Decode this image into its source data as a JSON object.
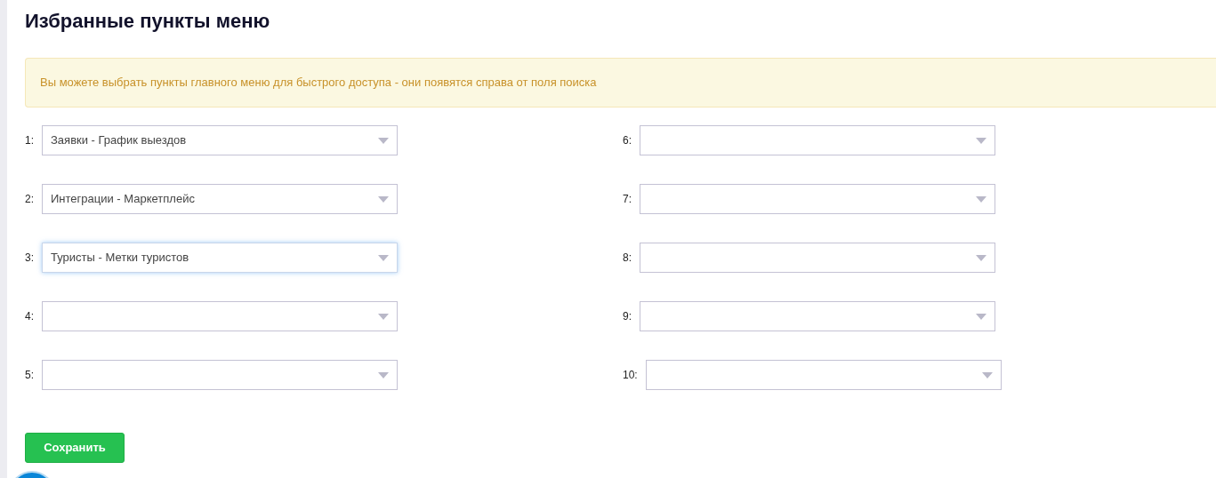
{
  "page": {
    "title": "Избранные пункты меню"
  },
  "notice": "Вы можете выбрать пункты главного меню для быстрого доступа - они появятся справа от поля поиска",
  "slots": [
    {
      "number": "1:",
      "value": "Заявки - График выездов",
      "focused": false
    },
    {
      "number": "2:",
      "value": "Интеграции - Маркетплейс",
      "focused": false
    },
    {
      "number": "3:",
      "value": "Туристы - Метки туристов",
      "focused": true
    },
    {
      "number": "4:",
      "focused": false
    },
    {
      "number": "5:",
      "focused": false
    },
    {
      "number": "6:",
      "focused": false
    },
    {
      "number": "7:",
      "focused": false
    },
    {
      "number": "8:",
      "focused": false
    },
    {
      "number": "9:",
      "focused": false
    },
    {
      "number": "10:",
      "focused": false
    }
  ],
  "save_button": "Сохранить"
}
